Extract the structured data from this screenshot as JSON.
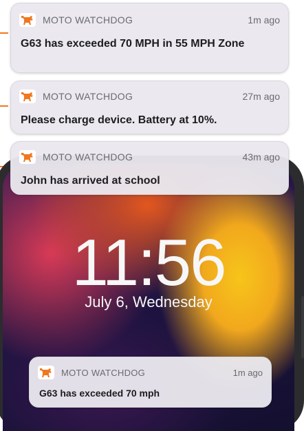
{
  "lock_screen": {
    "time": "11:56",
    "date": "July 6, Wednesday"
  },
  "notifications": [
    {
      "app": "MOTO WATCHDOG",
      "time": "1m ago",
      "message": "G63 has exceeded 70 MPH in 55 MPH Zone",
      "icon": "dog-icon"
    },
    {
      "app": "MOTO WATCHDOG",
      "time": "27m ago",
      "message": "Please charge device. Battery at 10%.",
      "icon": "dog-icon"
    },
    {
      "app": "MOTO WATCHDOG",
      "time": "43m ago",
      "message": "John has arrived at school",
      "icon": "dog-icon"
    },
    {
      "app": "MOTO WATCHDOG",
      "time": "1m ago",
      "message": "G63 has exceeded 70 mph",
      "icon": "dog-icon"
    }
  ],
  "colors": {
    "accent": "#f0781e",
    "card_background": "#eae8ee"
  }
}
